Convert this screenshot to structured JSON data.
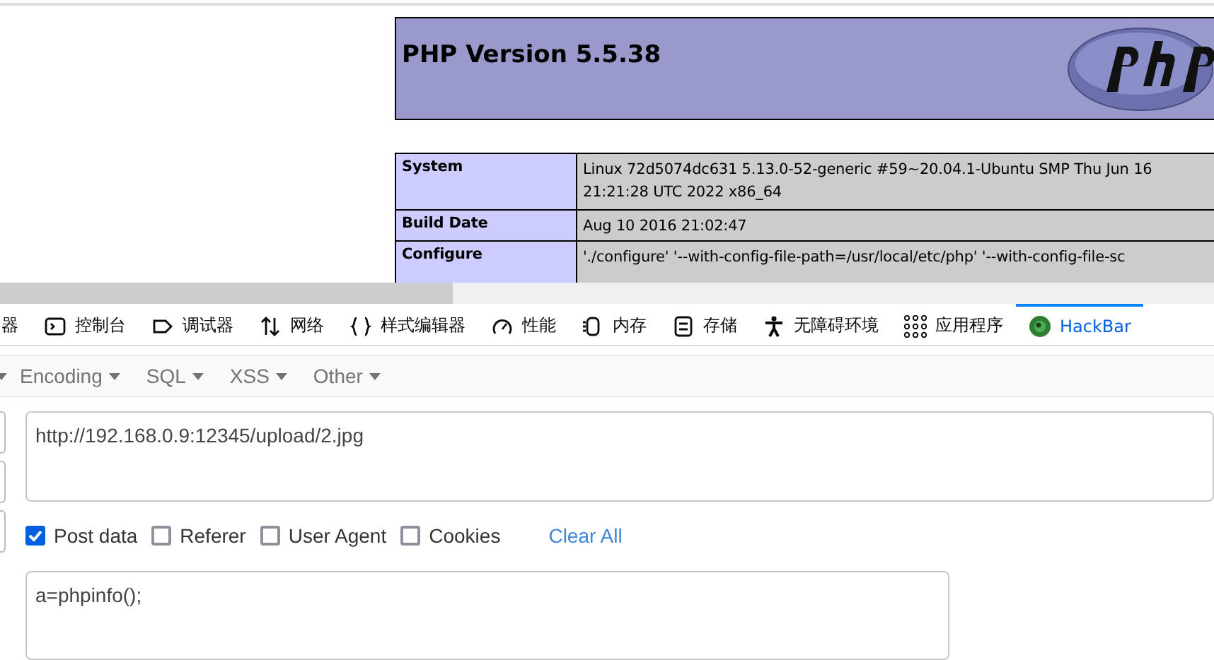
{
  "php_page": {
    "title": "PHP Version 5.5.38",
    "rows": [
      {
        "key": "System",
        "value_lines": [
          "Linux 72d5074dc631 5.13.0-52-generic #59~20.04.1-Ubuntu SMP Thu Jun 16",
          "21:21:28 UTC 2022 x86_64"
        ]
      },
      {
        "key": "Build Date",
        "value_lines": [
          "Aug 10 2016 21:02:47"
        ]
      },
      {
        "key": "Configure",
        "value_lines": [
          "'./configure' '--with-config-file-path=/usr/local/etc/php' '--with-config-file-sc"
        ]
      }
    ]
  },
  "devtools_tabs": [
    {
      "label": "器",
      "selected": false
    },
    {
      "label": "控制台",
      "selected": false
    },
    {
      "label": "调试器",
      "selected": false
    },
    {
      "label": "网络",
      "selected": false
    },
    {
      "label": "样式编辑器",
      "selected": false
    },
    {
      "label": "性能",
      "selected": false
    },
    {
      "label": "内存",
      "selected": false
    },
    {
      "label": "存储",
      "selected": false
    },
    {
      "label": "无障碍环境",
      "selected": false
    },
    {
      "label": "应用程序",
      "selected": false
    },
    {
      "label": "HackBar",
      "selected": true
    }
  ],
  "hackbar_menu": [
    "Encoding",
    "SQL",
    "XSS",
    "Other"
  ],
  "url_field": {
    "value": "http://192.168.0.9:12345/upload/2.jpg"
  },
  "options": [
    {
      "label": "Post data",
      "checked": true
    },
    {
      "label": "Referer",
      "checked": false
    },
    {
      "label": "User Agent",
      "checked": false
    },
    {
      "label": "Cookies",
      "checked": false
    }
  ],
  "clear_all": "Clear All",
  "post_field": {
    "value": "a=phpinfo();"
  }
}
